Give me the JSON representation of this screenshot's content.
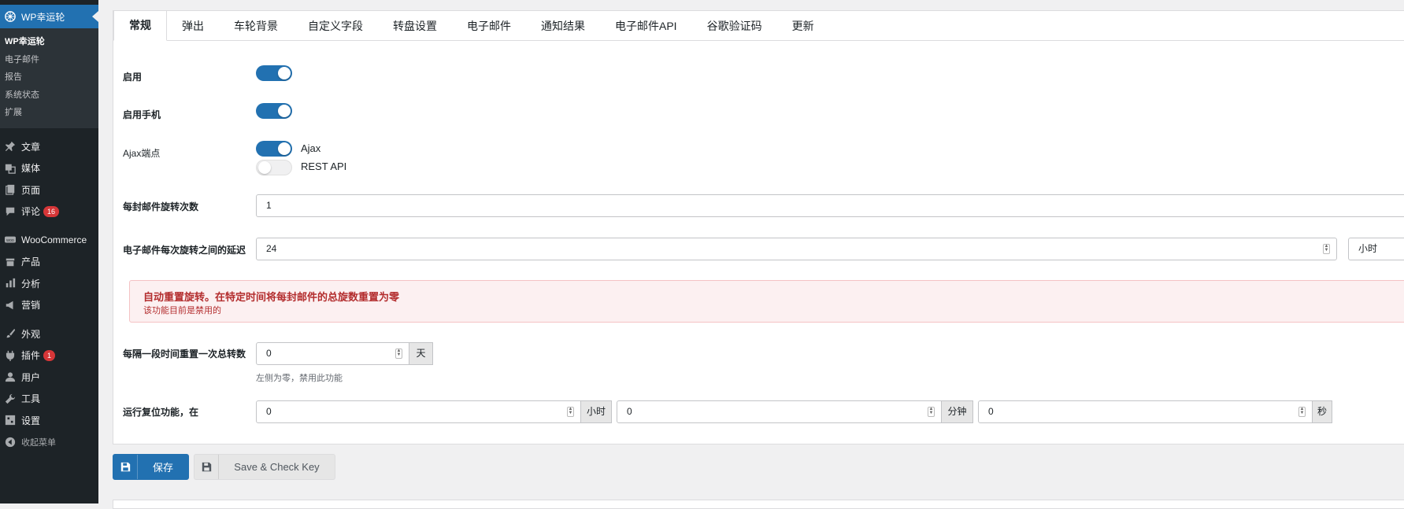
{
  "sidebar": {
    "plugin_title": "WP幸运轮",
    "submenu": [
      {
        "label": "WP幸运轮",
        "current": true
      },
      {
        "label": "电子邮件"
      },
      {
        "label": "报告"
      },
      {
        "label": "系统状态"
      },
      {
        "label": "扩展"
      }
    ],
    "menu": [
      {
        "label": "文章",
        "icon": "pin-icon"
      },
      {
        "label": "媒体",
        "icon": "media-icon"
      },
      {
        "label": "页面",
        "icon": "page-icon"
      },
      {
        "label": "评论",
        "icon": "comment-icon",
        "badge": "16"
      },
      {
        "label": "WooCommerce",
        "icon": "woocommerce-icon"
      },
      {
        "label": "产品",
        "icon": "product-icon"
      },
      {
        "label": "分析",
        "icon": "analytics-icon"
      },
      {
        "label": "营销",
        "icon": "megaphone-icon"
      },
      {
        "label": "外观",
        "icon": "brush-icon"
      },
      {
        "label": "插件",
        "icon": "plugin-icon",
        "badge": "1"
      },
      {
        "label": "用户",
        "icon": "user-icon"
      },
      {
        "label": "工具",
        "icon": "wrench-icon"
      },
      {
        "label": "设置",
        "icon": "settings-icon"
      },
      {
        "label": "收起菜单",
        "icon": "collapse-icon"
      }
    ]
  },
  "tabs": [
    "常规",
    "弹出",
    "车轮背景",
    "自定义字段",
    "转盘设置",
    "电子邮件",
    "通知结果",
    "电子邮件API",
    "谷歌验证码",
    "更新"
  ],
  "form": {
    "enable_label": "启用",
    "enable_mobile_label": "启用手机",
    "ajax_label": "Ajax端点",
    "ajax_option": "Ajax",
    "rest_option": "REST API",
    "spins_per_email_label": "每封邮件旋转次数",
    "spins_per_email_value": "1",
    "delay_label": "电子邮件每次旋转之间的延迟",
    "delay_value": "24",
    "delay_unit": "小时",
    "notice_title": "自动重置旋转。在特定时间将每封邮件的总旋数重置为零",
    "notice_sub": "该功能目前是禁用的",
    "reset_period_label": "每隔一段时间重置一次总转数",
    "reset_period_value": "0",
    "reset_period_unit": "天",
    "reset_period_help": "左侧为零，禁用此功能",
    "run_reset_label": "运行复位功能，在",
    "hours_value": "0",
    "hours_unit": "小时",
    "minutes_value": "0",
    "minutes_unit": "分钟",
    "seconds_value": "0",
    "seconds_unit": "秒"
  },
  "buttons": {
    "save": "保存",
    "save_check": "Save & Check Key"
  },
  "colors": {
    "sidebar_bg": "#1d2327",
    "accent": "#2271b1",
    "notice_text": "#b32d2e"
  }
}
